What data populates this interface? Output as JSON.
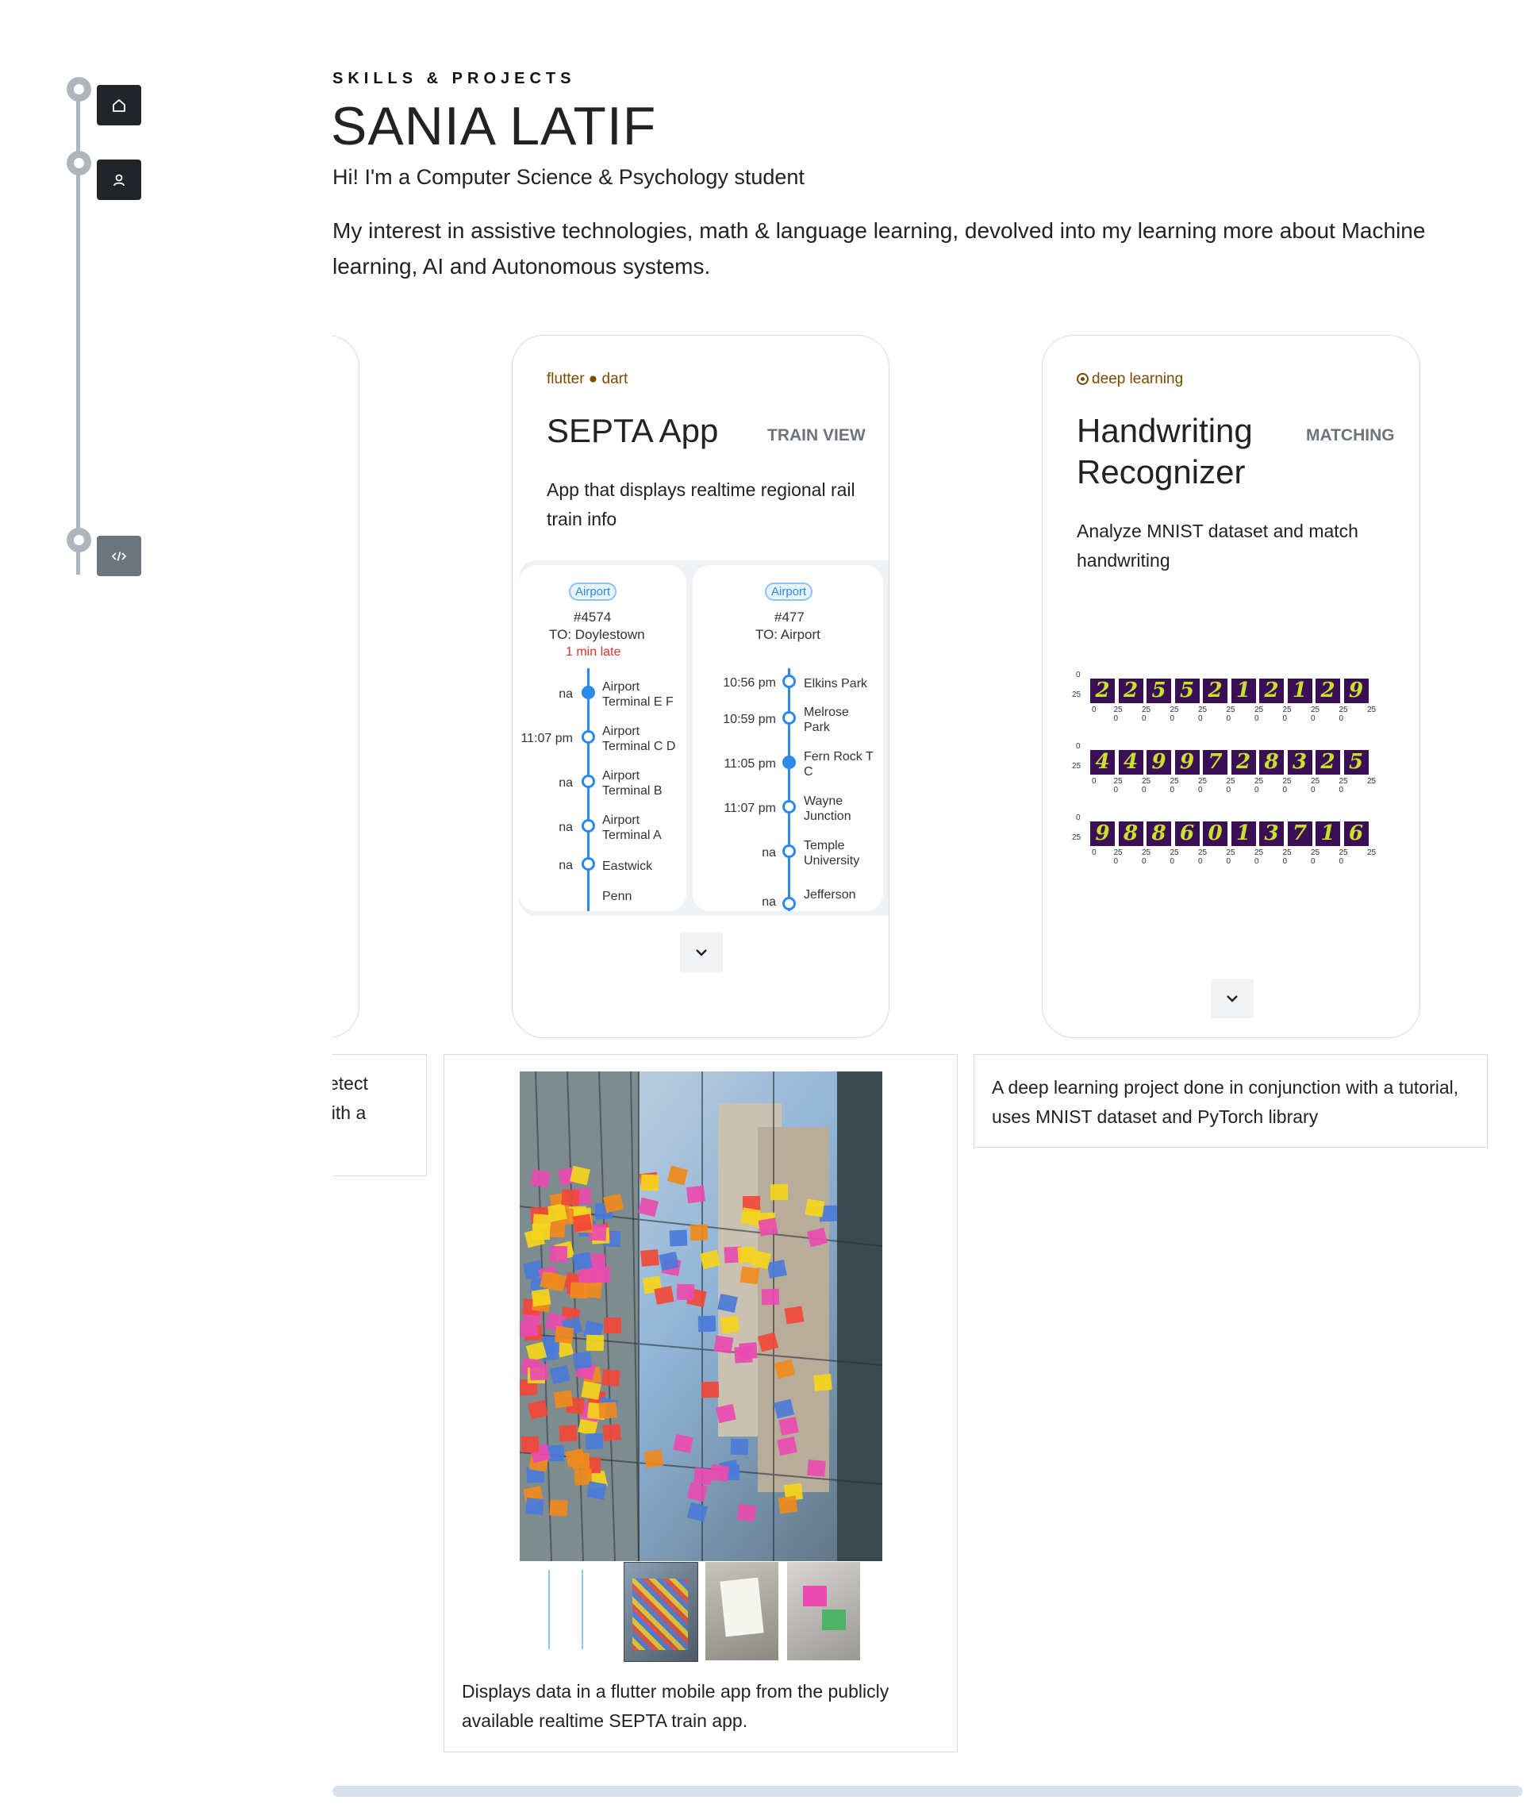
{
  "sidebar": {
    "nav": [
      {
        "icon": "home-icon",
        "label": "Home"
      },
      {
        "icon": "person-icon",
        "label": "About"
      },
      {
        "icon": "code-icon",
        "label": "Projects"
      }
    ]
  },
  "header": {
    "eyebrow": "SKILLS & PROJECTS",
    "name": "SANIA LATIF",
    "tagline": "Hi! I'm a Computer Science & Psychology student",
    "intro": "My interest in assistive technologies, math & language learning, devolved into my learning more about Machine learning, AI and Autonomous systems."
  },
  "projects": [
    {
      "tag": "flutter ● dart",
      "title": "SEPTA App",
      "badge": "TRAIN VIEW",
      "desc": "App that displays realtime regional rail train info",
      "detail": "Displays data in a flutter mobile app from the publicly available realtime SEPTA train app."
    },
    {
      "tag": "deep learning",
      "title": "Handwriting Recognizer",
      "badge": "MATCHING",
      "desc": "Analyze MNIST dataset and match handwriting",
      "detail": "A deep learning project done in conjunction with a tutorial, uses MNIST dataset and PyTorch library"
    }
  ],
  "partial_panel": {
    "line1": "o detect",
    "line2": "n with a"
  },
  "train_screens": [
    {
      "pill": "Airport",
      "train_no": "#4574",
      "dest": "TO: Doylestown",
      "late": "1 min late",
      "stops": [
        {
          "time": "na",
          "name": "Airport Terminal E F",
          "filled": true
        },
        {
          "time": "11:07 pm",
          "name": "Airport Terminal C D",
          "filled": false
        },
        {
          "time": "na",
          "name": "Airport Terminal B",
          "filled": false
        },
        {
          "time": "na",
          "name": "Airport Terminal A",
          "filled": false
        },
        {
          "time": "na",
          "name": "Eastwick",
          "filled": false
        },
        {
          "time": "",
          "name": "Penn",
          "filled": false
        }
      ]
    },
    {
      "pill": "Airport",
      "train_no": "#477",
      "dest": "TO: Airport",
      "late": "",
      "stops": [
        {
          "time": "10:56 pm",
          "name": "Elkins Park",
          "filled": false
        },
        {
          "time": "10:59 pm",
          "name": "Melrose Park",
          "filled": false
        },
        {
          "time": "11:05 pm",
          "name": "Fern Rock T C",
          "filled": true
        },
        {
          "time": "11:07 pm",
          "name": "Wayne Junction",
          "filled": false
        },
        {
          "time": "na",
          "name": "Temple University",
          "filled": false
        },
        {
          "time": "na",
          "name": "Jefferson",
          "filled": false
        }
      ]
    }
  ],
  "mnist_rows": [
    {
      "digits": [
        "2",
        "2",
        "5",
        "5",
        "2",
        "1",
        "2",
        "1",
        "2",
        "9"
      ]
    },
    {
      "digits": [
        "4",
        "4",
        "9",
        "9",
        "7",
        "2",
        "8",
        "3",
        "2",
        "5"
      ]
    },
    {
      "digits": [
        "9",
        "8",
        "8",
        "6",
        "0",
        "1",
        "3",
        "7",
        "1",
        "6"
      ]
    }
  ],
  "mnist_axis": {
    "y0": "0",
    "y1": "25",
    "x0": "0",
    "x1": "25",
    "x_mid": "25 0"
  },
  "colors": {
    "accent": "#2b8be6",
    "dark_button": "#212529",
    "muted_button": "#6c757d",
    "tag": "#7a4a00",
    "late": "#e03131"
  }
}
